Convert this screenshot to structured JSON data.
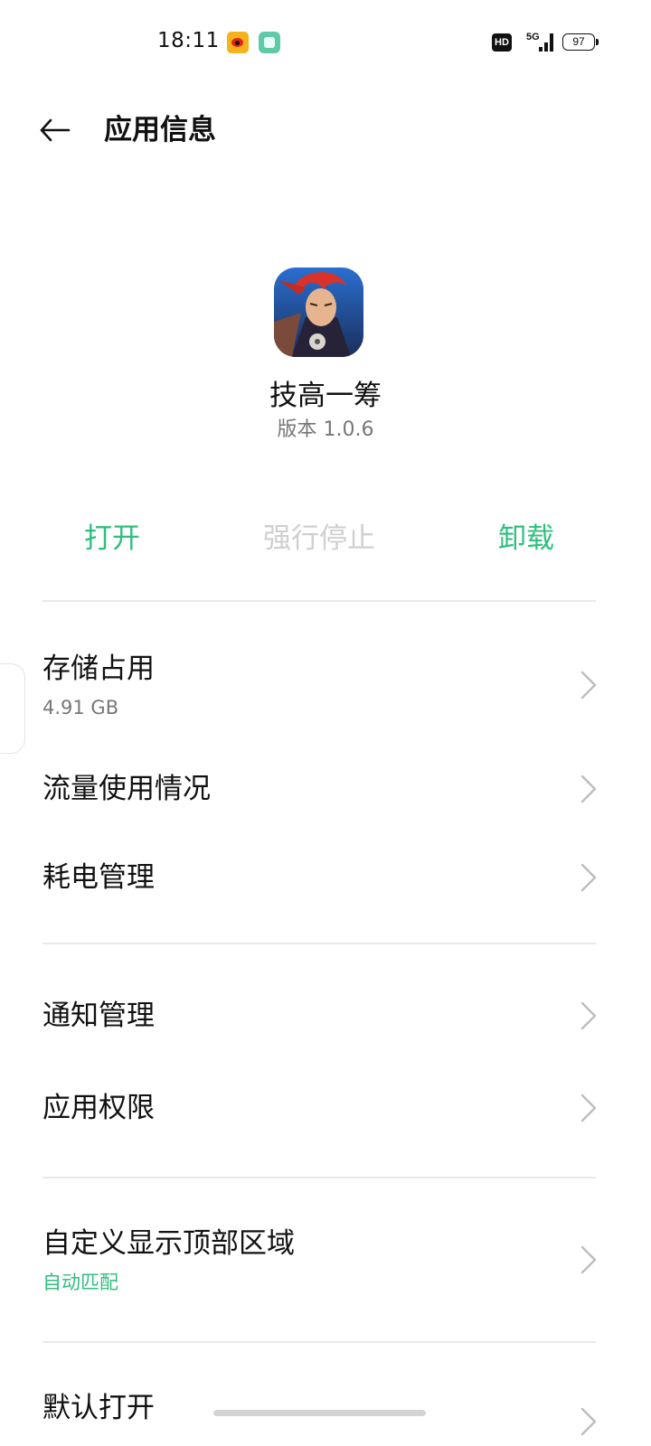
{
  "status_bar": {
    "time": "18:11",
    "hd_label": "HD",
    "network_label": "5G",
    "battery": "97"
  },
  "header": {
    "title": "应用信息"
  },
  "app": {
    "name": "技高一筹",
    "version": "版本 1.0.6"
  },
  "actions": {
    "open": "打开",
    "force_stop": "强行停止",
    "uninstall": "卸载"
  },
  "rows": {
    "storage": {
      "title": "存储占用",
      "subtitle": "4.91 GB"
    },
    "data_usage": {
      "title": "流量使用情况"
    },
    "battery": {
      "title": "耗电管理"
    },
    "notifications": {
      "title": "通知管理"
    },
    "permissions": {
      "title": "应用权限"
    },
    "display_area": {
      "title": "自定义显示顶部区域",
      "subtitle": "自动匹配"
    },
    "default_open": {
      "title": "默认打开"
    }
  },
  "colors": {
    "accent": "#2fbf7e",
    "disabled": "#cfcfcf",
    "secondary_text": "#777777",
    "divider": "#e9e9e9"
  },
  "icons": {
    "back": "arrow-left-icon",
    "chevron": "chevron-right-icon",
    "weibo": "weibo-icon",
    "app_notification": "app-notification-icon",
    "signal": "signal-icon",
    "battery": "battery-icon"
  }
}
